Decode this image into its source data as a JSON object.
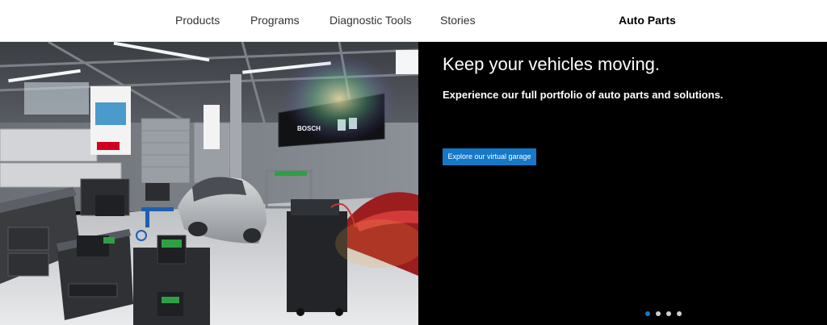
{
  "nav": {
    "items": [
      {
        "label": "Products"
      },
      {
        "label": "Programs"
      },
      {
        "label": "Diagnostic Tools"
      },
      {
        "label": "Stories"
      }
    ],
    "active_label": "Auto Parts"
  },
  "hero": {
    "headline": "Keep your vehicles moving.",
    "subline": "Experience our full portfolio of auto parts and solutions.",
    "cta_label": "Explore our virtual garage",
    "image_brand_text": "BOSCH",
    "carousel": {
      "slide_count": 4,
      "active_index": 0
    }
  },
  "colors": {
    "accent": "#1578c8",
    "nav_text": "#333333",
    "panel_background": "#000000",
    "dot_inactive": "#cfcfcf"
  }
}
